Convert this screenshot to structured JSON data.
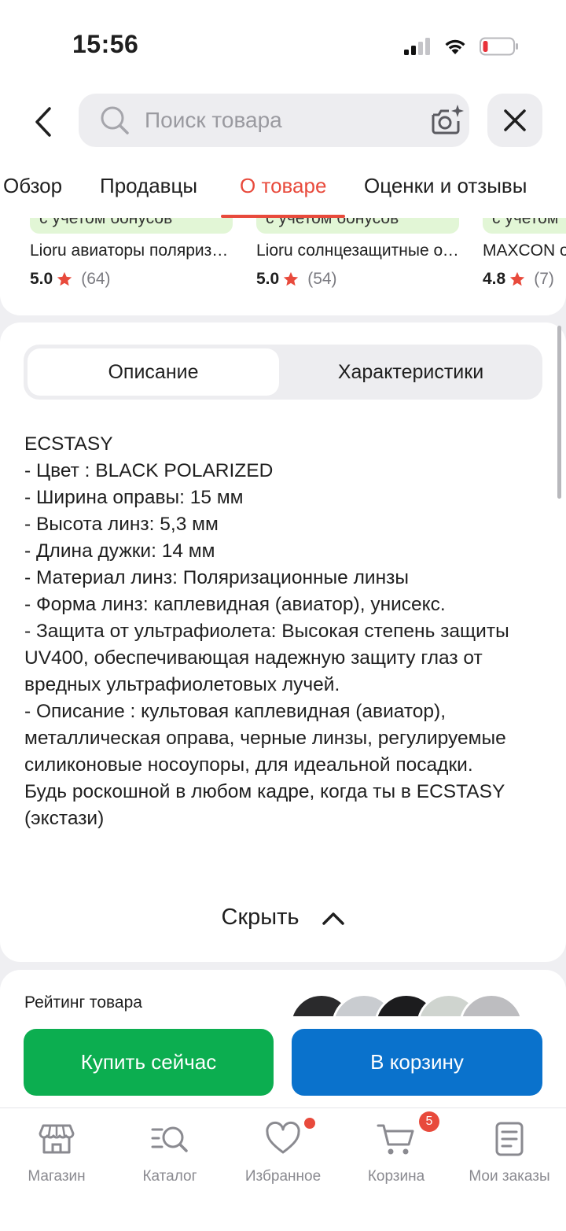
{
  "status_bar": {
    "time": "15:56"
  },
  "header": {
    "search_placeholder": "Поиск товара"
  },
  "tabs": [
    {
      "label": "Обзор"
    },
    {
      "label": "Продавцы"
    },
    {
      "label": "О товаре",
      "active": true
    },
    {
      "label": "Оценки и отзывы"
    }
  ],
  "similar_products": [
    {
      "bonus": "с учетом бонусов",
      "title": "Lioru авиаторы поляризационные",
      "score": "5.0",
      "count": "(64)"
    },
    {
      "bonus": "с учетом бонусов",
      "title": "Lioru солнцезащитные очки",
      "score": "5.0",
      "count": "(54)"
    },
    {
      "bonus": "с учетом",
      "title": "MAXCON о",
      "score": "4.8",
      "count": "(7)"
    }
  ],
  "description_tabs": {
    "description": "Описание",
    "characteristics": "Характеристики"
  },
  "description_lines": [
    "ECSTASY",
    "- Цвет : BLACK POLARIZED",
    "- Ширина оправы: 15 мм",
    "- Высота линз: 5,3 мм",
    "- Длина дужки: 14 мм",
    "- Материал линз: Поляризационные линзы",
    "- Форма линз: каплевидная (авиатор), унисекс.",
    "- Защита от ультрафиолета: Высокая степень защиты UV400, обеспечивающая надежную защиту глаз от вредных ультрафиолетовых лучей.",
    "- Описание : культовая каплевидная (авиатор), металлическая оправа, черные линзы, регулируемые силиконовые носоупоры, для идеальной посадки.",
    "Будь роскошной в любом кадре, когда ты в ECSTASY (экстази)"
  ],
  "hide_label": "Скрыть",
  "rating_section": {
    "title": "Рейтинг товара"
  },
  "actions": {
    "buy_now": "Купить сейчас",
    "add_to_cart": "В корзину"
  },
  "bottom_nav": [
    {
      "label": "Магазин",
      "icon": "shop-icon"
    },
    {
      "label": "Каталог",
      "icon": "catalog-icon"
    },
    {
      "label": "Избранное",
      "icon": "heart-icon"
    },
    {
      "label": "Корзина",
      "icon": "cart-icon",
      "badge": "5"
    },
    {
      "label": "Мои заказы",
      "icon": "orders-icon"
    }
  ],
  "colors": {
    "accent": "#e84a3c",
    "buy": "#0cae50",
    "cart": "#0a72cc",
    "bonus_bg": "#e2f6d6"
  }
}
